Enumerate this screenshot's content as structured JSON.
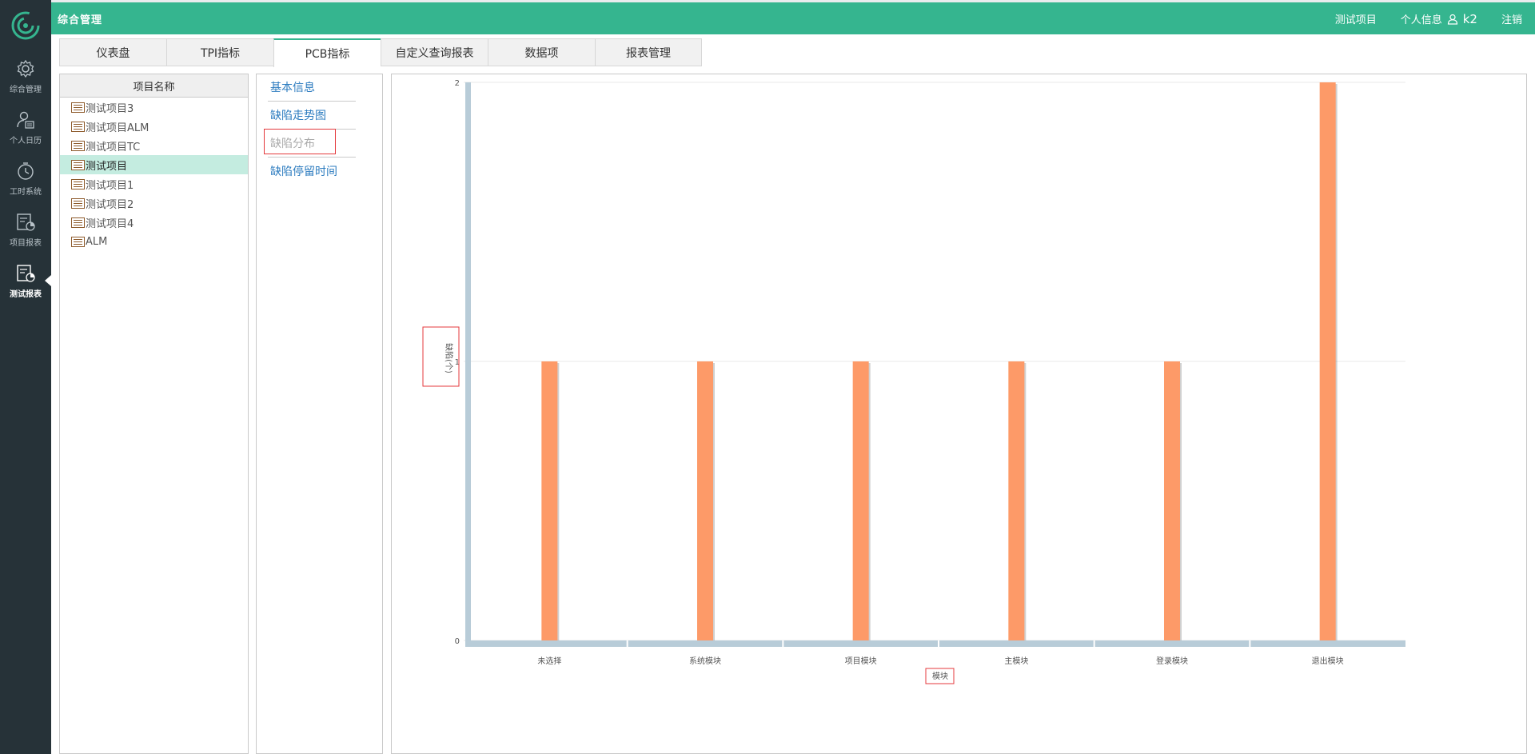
{
  "sidebar": {
    "items": [
      {
        "label": "综合管理",
        "icon": "gear-icon"
      },
      {
        "label": "个人日历",
        "icon": "user-calendar-icon"
      },
      {
        "label": "工时系统",
        "icon": "timer-icon"
      },
      {
        "label": "项目报表",
        "icon": "project-report-icon"
      },
      {
        "label": "测试报表",
        "icon": "test-report-icon"
      }
    ],
    "active_index": 4
  },
  "topbar": {
    "title": "综合管理",
    "project": "测试项目",
    "profile": "个人信息",
    "username": "k2",
    "logout": "注销"
  },
  "tabs": [
    {
      "label": "仪表盘"
    },
    {
      "label": "TPI指标"
    },
    {
      "label": "PCB指标"
    },
    {
      "label": "自定义查询报表"
    },
    {
      "label": "数据项"
    },
    {
      "label": "报表管理"
    }
  ],
  "active_tab": 2,
  "projects": {
    "header": "项目名称",
    "items": [
      "测试项目3",
      "测试项目ALM",
      "测试项目TC",
      "测试项目",
      "测试项目1",
      "测试项目2",
      "测试项目4",
      "ALM"
    ],
    "selected_index": 3
  },
  "submenu": {
    "items": [
      "基本信息",
      "缺陷走势图",
      "缺陷分布",
      "缺陷停留时间"
    ],
    "active_index": 2
  },
  "colors": {
    "accent": "#35b58f",
    "sidebar_bg": "#263238",
    "bar": "#fd9a68",
    "axis": "#b8ccd8",
    "link": "#2b7bbf"
  },
  "chart_data": {
    "type": "bar",
    "categories": [
      "未选择",
      "系统模块",
      "项目模块",
      "主模块",
      "登录模块",
      "退出模块"
    ],
    "values": [
      1,
      1,
      1,
      1,
      1,
      2
    ],
    "xlabel": "模块",
    "ylabel": "缺陷(个)",
    "ylim": [
      0,
      2
    ],
    "yticks": [
      "0",
      "1",
      "2"
    ],
    "grid": true
  }
}
